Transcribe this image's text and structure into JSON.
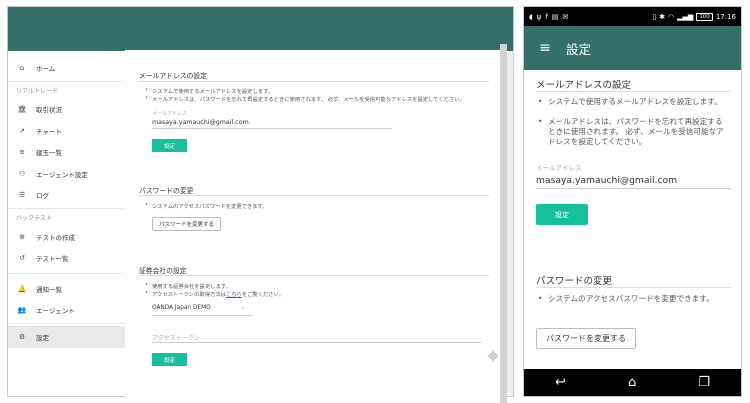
{
  "desktop": {
    "sidebar": {
      "items": [
        {
          "icon": "home-icon",
          "glyph": "⌂",
          "label": "ホーム"
        },
        {
          "icon": "bank-icon",
          "glyph": "🏛",
          "label": "取引状況"
        },
        {
          "icon": "trend-icon",
          "glyph": "↗",
          "label": "チャート"
        },
        {
          "icon": "list-icon",
          "glyph": "≡",
          "label": "建玉一覧"
        },
        {
          "icon": "agent-settings-icon",
          "glyph": "⚇",
          "label": "エージェント設定"
        },
        {
          "icon": "log-icon",
          "glyph": "☰",
          "label": "ログ"
        },
        {
          "icon": "add-circle-icon",
          "glyph": "⊕",
          "label": "テストの作成"
        },
        {
          "icon": "history-icon",
          "glyph": "↺",
          "label": "テスト一覧"
        },
        {
          "icon": "bell-icon",
          "glyph": "🔔",
          "label": "通知一覧"
        },
        {
          "icon": "people-icon",
          "glyph": "👥",
          "label": "エージェント"
        },
        {
          "icon": "gear-icon",
          "glyph": "⚙",
          "label": "設定"
        }
      ],
      "section_realtime": "リアルトレード",
      "section_backtest": "バックテスト"
    },
    "email": {
      "title": "メールアドレスの設定",
      "bullets": [
        "システムで使用するメールアドレスを設定します。",
        "メールアドレスは、パスワードを忘れて再設定するときに使用されます。 必ず、メールを受信可能なアドレスを設定してください。"
      ],
      "field_label": "メールアドレス",
      "field_value": "masaya.yamauchi@gmail.com",
      "button": "設定"
    },
    "password": {
      "title": "パスワードの変更",
      "bullets": [
        "システムのアクセスパスワードを変更できます。"
      ],
      "button": "パスワードを変更する"
    },
    "broker": {
      "title": "証券会社の設定",
      "bullet1": "使用する証券会社を設定します。",
      "bullet2_prefix": "アクセストークンの取得方法は",
      "bullet2_link": "こちら",
      "bullet2_suffix": "をご覧ください。",
      "select_value": "OANDA Japan DEMO",
      "token_placeholder": "アクセストークン",
      "button": "設定"
    }
  },
  "mobile": {
    "status": {
      "battery": "100",
      "time": "17:16"
    },
    "toolbar_title": "設定",
    "email": {
      "title": "メールアドレスの設定",
      "bullet1": "システムで使用するメールアドレスを設定します。",
      "bullet2": "メールアドレスは、パスワードを忘れて再設定するときに使用されます。 必ず、メールを受信可能なアドレスを設定してください。",
      "field_label": "メールアドレス",
      "field_value": "masaya.yamauchi@gmail.com",
      "button": "設定"
    },
    "password": {
      "title": "パスワードの変更",
      "bullet1": "システムのアクセスパスワードを変更できます。",
      "button": "パスワードを変更する"
    }
  },
  "colors": {
    "header": "#356f69",
    "accent_button": "#16c09c"
  }
}
